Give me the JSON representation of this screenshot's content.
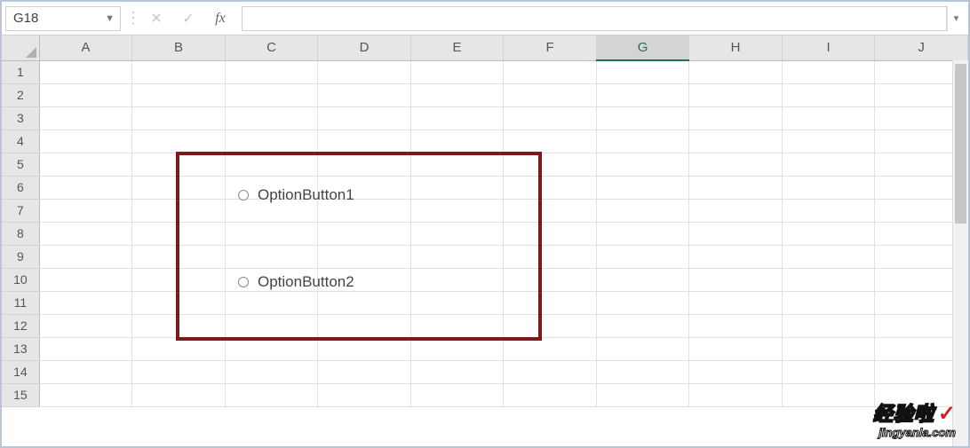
{
  "formula_bar": {
    "name_box": "G18",
    "cancel_glyph": "✕",
    "enter_glyph": "✓",
    "fx_glyph": "fx",
    "formula_value": ""
  },
  "grid": {
    "columns": [
      "A",
      "B",
      "C",
      "D",
      "E",
      "F",
      "G",
      "H",
      "I",
      "J"
    ],
    "active_column": "G",
    "rows": [
      "1",
      "2",
      "3",
      "4",
      "5",
      "6",
      "7",
      "8",
      "9",
      "10",
      "11",
      "12",
      "13",
      "14",
      "15"
    ]
  },
  "controls": {
    "option1": {
      "label": "OptionButton1",
      "checked": false
    },
    "option2": {
      "label": "OptionButton2",
      "checked": false
    }
  },
  "watermark": {
    "title": "经验啦",
    "check": "✓",
    "subtitle": "jingyanla.com"
  }
}
